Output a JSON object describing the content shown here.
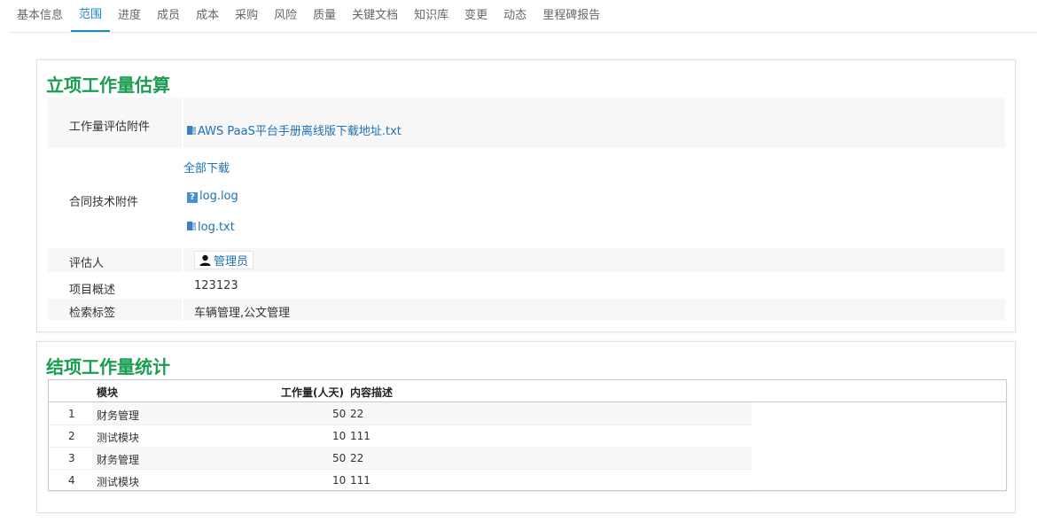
{
  "tabs": [
    {
      "label": "基本信息",
      "active": false
    },
    {
      "label": "范围",
      "active": true
    },
    {
      "label": "进度",
      "active": false
    },
    {
      "label": "成员",
      "active": false
    },
    {
      "label": "成本",
      "active": false
    },
    {
      "label": "采购",
      "active": false
    },
    {
      "label": "风险",
      "active": false
    },
    {
      "label": "质量",
      "active": false
    },
    {
      "label": "关键文档",
      "active": false
    },
    {
      "label": "知识库",
      "active": false
    },
    {
      "label": "变更",
      "active": false
    },
    {
      "label": "动态",
      "active": false
    },
    {
      "label": "里程碑报告",
      "active": false
    }
  ],
  "estimate": {
    "title": "立项工作量估算",
    "rows": {
      "attachment_label": "工作量评估附件",
      "attachment_file": "AWS PaaS平台手册离线版下载地址.txt",
      "contract_label": "合同技术附件",
      "download_all": "全部下载",
      "contract_files": [
        "log.log",
        "log.txt"
      ],
      "assessor_label": "评估人",
      "assessor_name": "管理员",
      "overview_label": "项目概述",
      "overview_value": "123123",
      "tags_label": "检索标签",
      "tags_value": "车辆管理,公文管理"
    }
  },
  "stats": {
    "title": "结项工作量统计",
    "columns": [
      "模块",
      "工作量(人天)",
      "内容描述"
    ],
    "rows": [
      {
        "index": "1",
        "module": "财务管理",
        "effort": "50",
        "desc": "22"
      },
      {
        "index": "2",
        "module": "测试模块",
        "effort": "10",
        "desc": "111"
      },
      {
        "index": "3",
        "module": "财务管理",
        "effort": "50",
        "desc": "22"
      },
      {
        "index": "4",
        "module": "测试模块",
        "effort": "10",
        "desc": "111"
      }
    ]
  },
  "colors": {
    "accent": "#1e88c8",
    "title_green": "#1a9d4e",
    "link": "#1e70b5"
  }
}
